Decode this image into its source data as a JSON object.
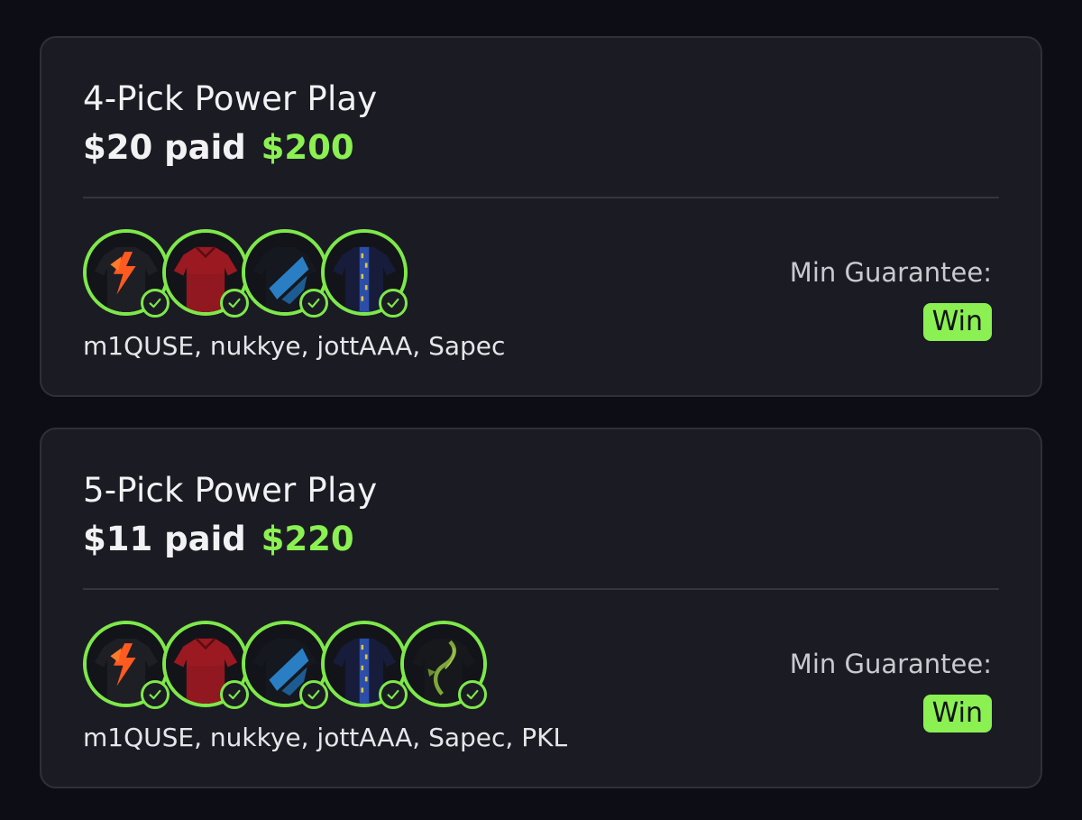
{
  "cards": [
    {
      "title": "4-Pick Power Play",
      "paid_label": "$20 paid",
      "payout": "$200",
      "picks": [
        {
          "jersey": "orange-black-jersey"
        },
        {
          "jersey": "red-jersey"
        },
        {
          "jersey": "blue-black-jersey"
        },
        {
          "jersey": "navy-pattern-jersey"
        }
      ],
      "players": "m1QUSE, nukkye, jottAAA, Sapec",
      "guarantee_label": "Min Guarantee:",
      "result": "Win"
    },
    {
      "title": "5-Pick Power Play",
      "paid_label": "$11 paid",
      "payout": "$220",
      "picks": [
        {
          "jersey": "orange-black-jersey"
        },
        {
          "jersey": "red-jersey"
        },
        {
          "jersey": "blue-black-jersey"
        },
        {
          "jersey": "navy-pattern-jersey"
        },
        {
          "jersey": "green-dragon-jersey"
        }
      ],
      "players": "m1QUSE, nukkye, jottAAA, Sapec, PKL",
      "guarantee_label": "Min Guarantee:",
      "result": "Win"
    }
  ],
  "colors": {
    "background": "#0d0e15",
    "card": "#1b1c23",
    "accent": "#8bf051",
    "ring": "#7ee84a"
  },
  "icons": {
    "check": "checkmark-circle-icon"
  }
}
